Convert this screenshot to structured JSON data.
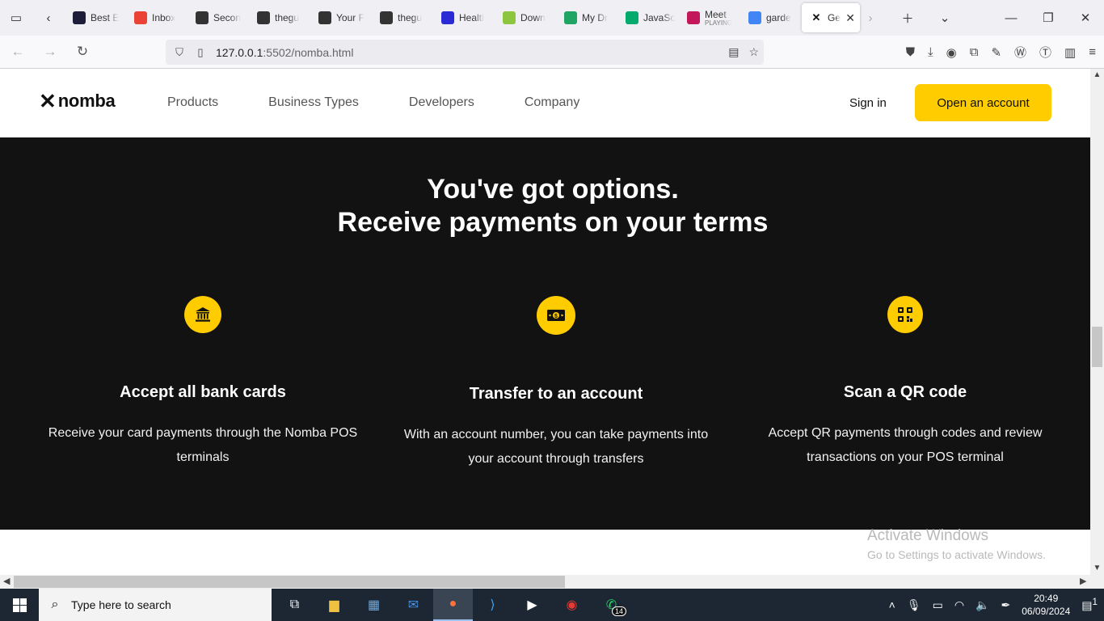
{
  "browser": {
    "tabs": [
      {
        "label": "Best E",
        "icon": "dark-square-icon",
        "color": "#1d1d3a"
      },
      {
        "label": "Inbox",
        "icon": "gmail-icon",
        "color": "#ea4335"
      },
      {
        "label": "Secon",
        "icon": "github-icon",
        "color": "#333333"
      },
      {
        "label": "thegu",
        "icon": "github-icon",
        "color": "#333333"
      },
      {
        "label": "Your F",
        "icon": "github-icon",
        "color": "#333333"
      },
      {
        "label": "thegu",
        "icon": "github-icon",
        "color": "#333333"
      },
      {
        "label": "Healtl",
        "icon": "blue-dot-icon",
        "color": "#2b2bd6"
      },
      {
        "label": "Down",
        "icon": "download-arrow-icon",
        "color": "#8cc63f"
      },
      {
        "label": "My Dr",
        "icon": "google-drive-icon",
        "color": "#1fa463"
      },
      {
        "label": "JavaSc",
        "icon": "w3-icon",
        "color": "#04aa6d"
      },
      {
        "label": "Meet",
        "sublabel": "PLAYING",
        "icon": "meet-icon",
        "color": "#c2185b"
      },
      {
        "label": "garde",
        "icon": "google-icon",
        "color": "#4285f4"
      }
    ],
    "active_tab": {
      "label": "Get",
      "icon": "nomba-x-icon"
    },
    "url": "127.0.0.1:5502/nomba.html",
    "url_host": "127.0.0.1",
    "url_rest": ":5502/nomba.html"
  },
  "site": {
    "logo_text": "nomba",
    "logo_mark": "✕",
    "nav": [
      "Products",
      "Business Types",
      "Developers",
      "Company"
    ],
    "sign_in": "Sign in",
    "cta": "Open an account",
    "accent": "#ffcc00"
  },
  "hero": {
    "line1": "You've got options.",
    "line2": "Receive payments on your terms"
  },
  "features": [
    {
      "icon": "bank-icon",
      "title": "Accept all bank cards",
      "desc_line1": "Receive your card payments through the Nomba POS",
      "desc_line2": "terminals"
    },
    {
      "icon": "cash-icon",
      "title": "Transfer to an account",
      "desc_line1": "With an account number, you can take payments into",
      "desc_line2": "your account through transfers"
    },
    {
      "icon": "qr-code-icon",
      "title": "Scan a QR code",
      "desc_line1": "Accept QR payments through codes and review",
      "desc_line2": "transactions on your POS terminal"
    }
  ],
  "watermark": {
    "line1": "Activate Windows",
    "line2": "Go to Settings to activate Windows."
  },
  "taskbar": {
    "search_placeholder": "Type here to search",
    "whatsapp_badge": "14",
    "time": "20:49",
    "date": "06/09/2024",
    "notification_count": "1"
  }
}
